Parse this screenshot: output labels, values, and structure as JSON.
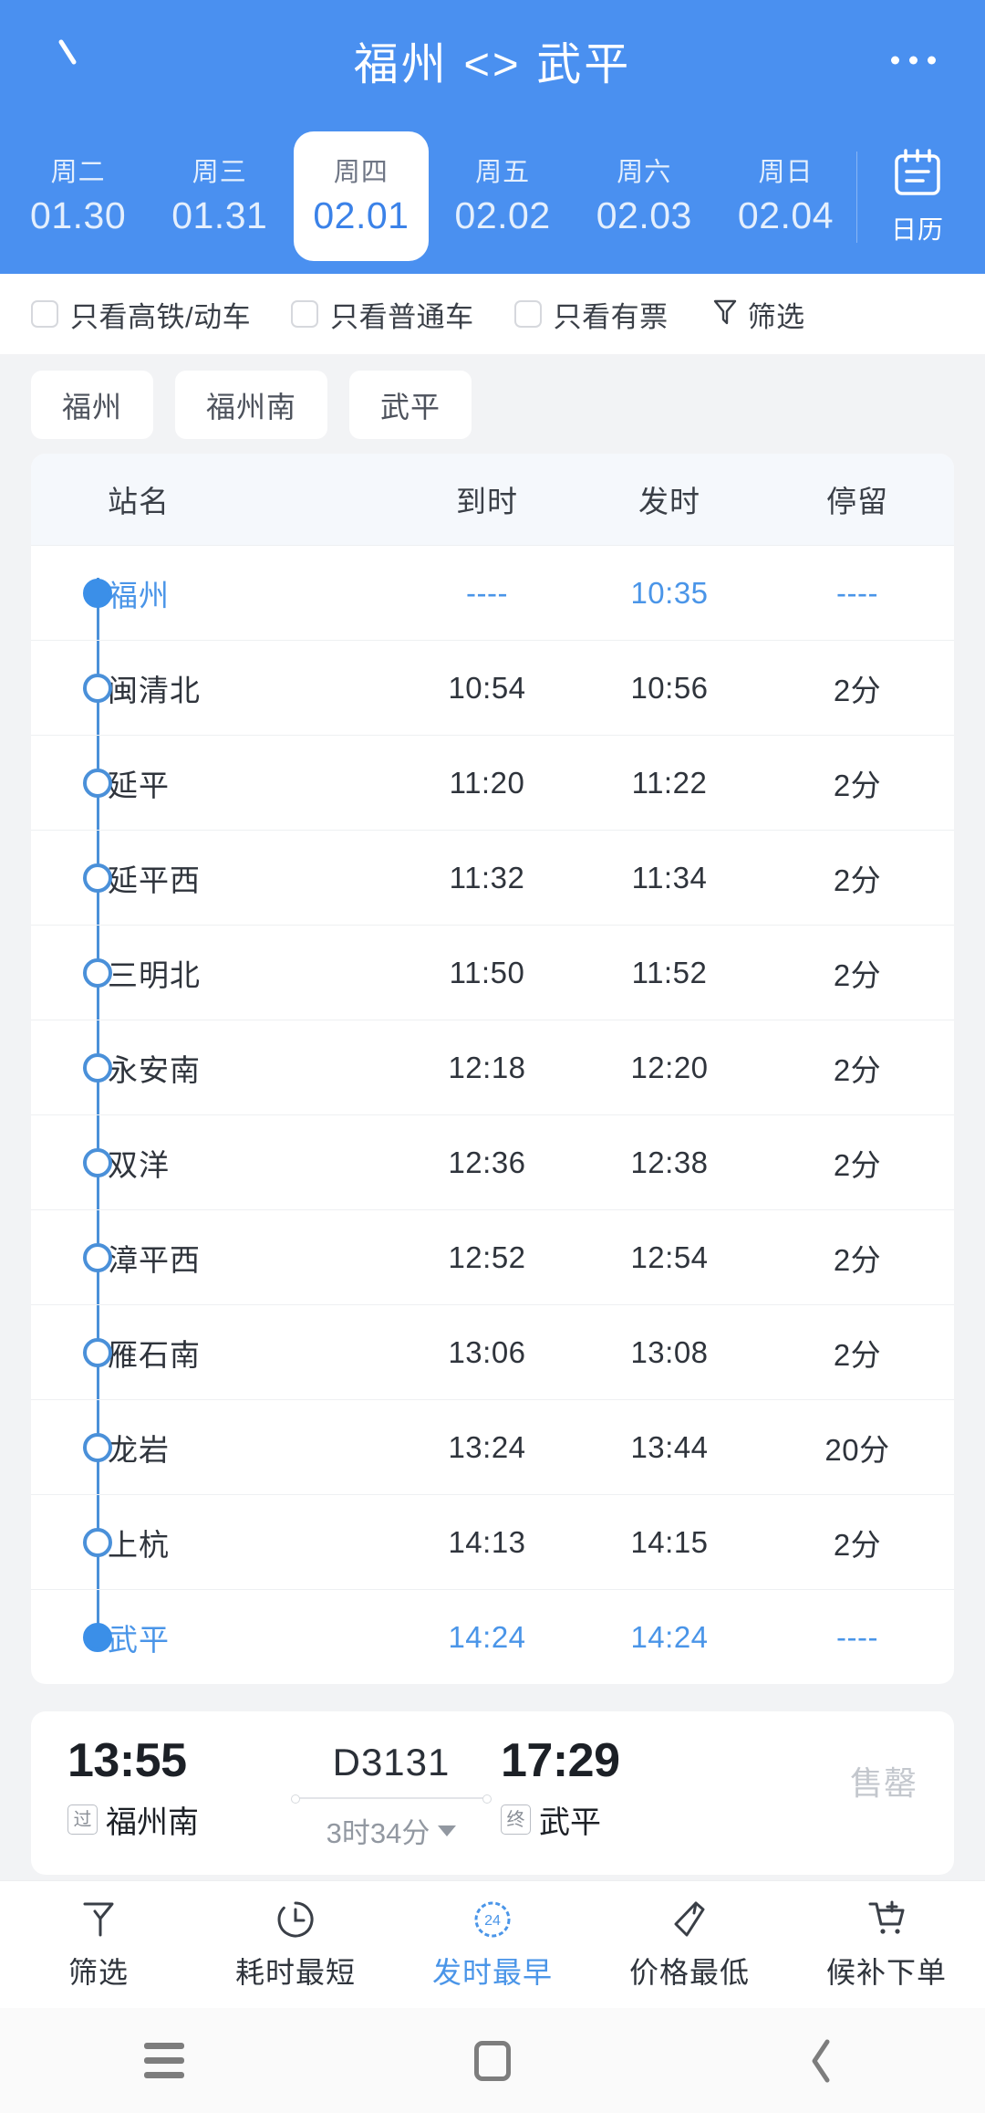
{
  "header": {
    "title": "福州 <> 武平",
    "back_icon": "back-chevron-icon",
    "more_icon": "more-options-icon",
    "calendar": {
      "icon": "calendar-icon",
      "label": "日历"
    },
    "dates": [
      {
        "dow": "周二",
        "date": "01.30",
        "active": false
      },
      {
        "dow": "周三",
        "date": "01.31",
        "active": false
      },
      {
        "dow": "周四",
        "date": "02.01",
        "active": true
      },
      {
        "dow": "周五",
        "date": "02.02",
        "active": false
      },
      {
        "dow": "周六",
        "date": "02.03",
        "active": false
      },
      {
        "dow": "周日",
        "date": "02.04",
        "active": false
      }
    ]
  },
  "filters": {
    "checkboxes": [
      {
        "label": "只看高铁/动车",
        "checked": false
      },
      {
        "label": "只看普通车",
        "checked": false
      },
      {
        "label": "只看有票",
        "checked": false
      }
    ],
    "filter_link": {
      "label": "筛选",
      "icon": "funnel-icon"
    }
  },
  "station_chips": [
    "福州",
    "福州南",
    "武平"
  ],
  "schedule": {
    "columns": [
      "站名",
      "到时",
      "发时",
      "停留"
    ],
    "rows": [
      {
        "station": "福州",
        "arrive": "----",
        "depart": "10:35",
        "stop": "----",
        "endpoint": true,
        "filled": true
      },
      {
        "station": "闽清北",
        "arrive": "10:54",
        "depart": "10:56",
        "stop": "2分",
        "endpoint": false,
        "filled": false
      },
      {
        "station": "延平",
        "arrive": "11:20",
        "depart": "11:22",
        "stop": "2分",
        "endpoint": false,
        "filled": false
      },
      {
        "station": "延平西",
        "arrive": "11:32",
        "depart": "11:34",
        "stop": "2分",
        "endpoint": false,
        "filled": false
      },
      {
        "station": "三明北",
        "arrive": "11:50",
        "depart": "11:52",
        "stop": "2分",
        "endpoint": false,
        "filled": false
      },
      {
        "station": "永安南",
        "arrive": "12:18",
        "depart": "12:20",
        "stop": "2分",
        "endpoint": false,
        "filled": false
      },
      {
        "station": "双洋",
        "arrive": "12:36",
        "depart": "12:38",
        "stop": "2分",
        "endpoint": false,
        "filled": false
      },
      {
        "station": "漳平西",
        "arrive": "12:52",
        "depart": "12:54",
        "stop": "2分",
        "endpoint": false,
        "filled": false
      },
      {
        "station": "雁石南",
        "arrive": "13:06",
        "depart": "13:08",
        "stop": "2分",
        "endpoint": false,
        "filled": false
      },
      {
        "station": "龙岩",
        "arrive": "13:24",
        "depart": "13:44",
        "stop": "20分",
        "endpoint": false,
        "filled": false
      },
      {
        "station": "上杭",
        "arrive": "14:13",
        "depart": "14:15",
        "stop": "2分",
        "endpoint": false,
        "filled": false
      },
      {
        "station": "武平",
        "arrive": "14:24",
        "depart": "14:24",
        "stop": "----",
        "endpoint": true,
        "filled": true
      }
    ]
  },
  "train_card": {
    "depart_time": "13:55",
    "depart_tag": "过",
    "depart_station": "福州南",
    "train_code": "D3131",
    "duration": "3时34分",
    "arrive_time": "17:29",
    "arrive_tag": "终",
    "arrive_station": "武平",
    "status": "售罄"
  },
  "toolbar": [
    {
      "label": "筛选",
      "icon": "funnel-icon",
      "active": false
    },
    {
      "label": "耗时最短",
      "icon": "clock-icon",
      "active": false
    },
    {
      "label": "发时最早",
      "icon": "clock-24-icon",
      "active": true
    },
    {
      "label": "价格最低",
      "icon": "price-tag-icon",
      "active": false
    },
    {
      "label": "候补下单",
      "icon": "cart-plus-icon",
      "active": false
    }
  ],
  "system_nav": [
    {
      "icon": "recents-icon"
    },
    {
      "icon": "home-icon"
    },
    {
      "icon": "back-icon"
    }
  ],
  "colors": {
    "brand_blue": "#4a90f0",
    "accent_blue": "#4a95e8",
    "page_bg": "#f2f3f5",
    "text_primary": "#2f343c",
    "muted": "#9298a1"
  }
}
